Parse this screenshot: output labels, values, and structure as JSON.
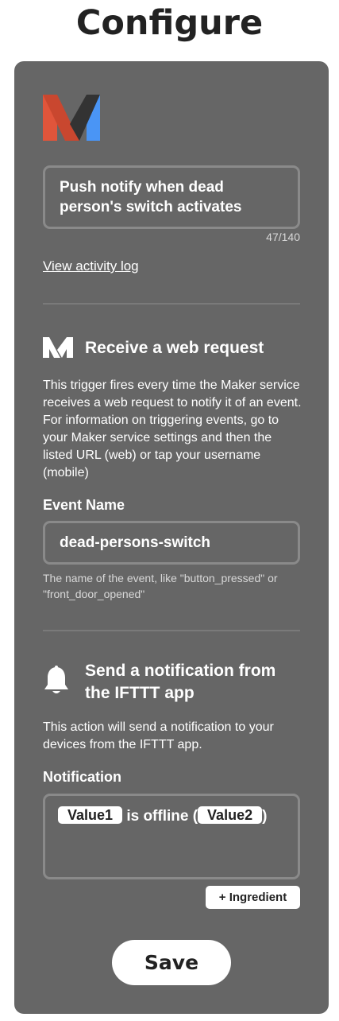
{
  "header": {
    "title": "Configure"
  },
  "applet": {
    "logo_icon": "maker-logo",
    "title_text": "Push notify when dead\nperson's switch activates",
    "char_count": "47/140",
    "activity_link": "View activity log"
  },
  "trigger": {
    "icon": "maker-icon",
    "title": "Receive a web request",
    "description": "This trigger fires every time the Maker service receives a web request to notify it of an event. For information on triggering events, go to your Maker service settings and then the listed URL (web) or tap your username (mobile)",
    "field_label": "Event Name",
    "field_value": "dead-persons-switch",
    "helper": "The name of the event, like \"button_pressed\" or \"front_door_opened\""
  },
  "action": {
    "icon": "bell-icon",
    "title": "Send a notification from the IFTTT app",
    "description": "This action will send a notification to your devices from the IFTTT app.",
    "field_label": "Notification",
    "ingredient_1": "Value1",
    "text_1": " is offline (",
    "ingredient_2": "Value2",
    "text_2": ")",
    "ingredient_button": "+ Ingredient"
  },
  "footer": {
    "save_label": "Save"
  },
  "colors": {
    "card_bg": "#666666",
    "maker_red": "#e0553b",
    "maker_blue": "#4a95f5",
    "maker_dark": "#333333"
  }
}
